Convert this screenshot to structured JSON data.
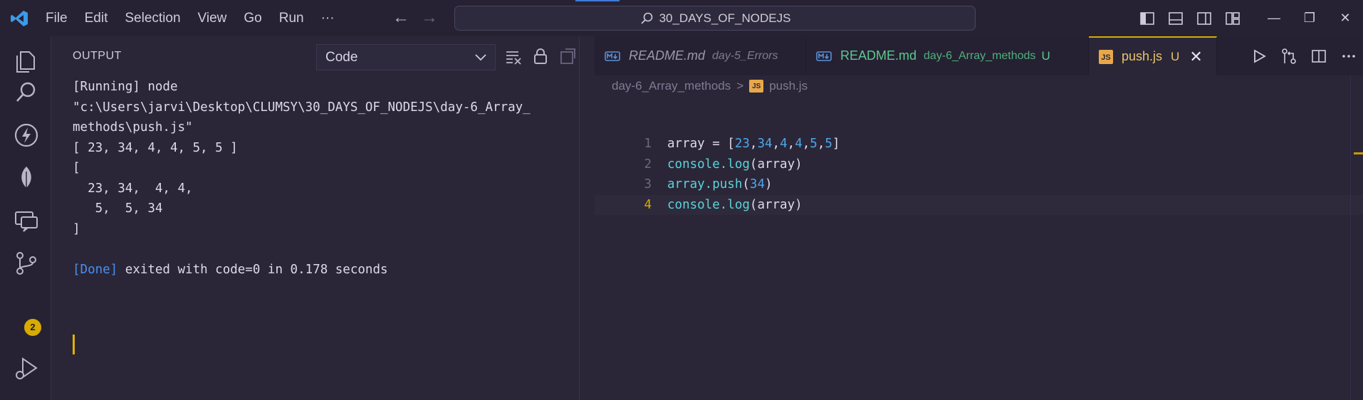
{
  "titlebar": {
    "menu": [
      "File",
      "Edit",
      "Selection",
      "View",
      "Go",
      "Run",
      "···"
    ],
    "search_text": "30_DAYS_OF_NODEJS",
    "window_controls": [
      "—",
      "❐",
      "✕"
    ]
  },
  "activitybar": {
    "items": [
      "explorer-icon",
      "search-icon",
      "thunder-icon",
      "leaf-icon",
      "remote-explorer-icon",
      "source-control-icon",
      "run-debug-icon"
    ],
    "source_control_badge": "2"
  },
  "output": {
    "title": "OUTPUT",
    "channel": "Code",
    "lines": [
      "[Running] node",
      "\"c:\\Users\\jarvi\\Desktop\\CLUMSY\\30_DAYS_OF_NODEJS\\day-6_Array_",
      "methods\\push.js\"",
      "[ 23, 34, 4, 4, 5, 5 ]",
      "[",
      "  23, 34,  4, 4,",
      "   5,  5, 34",
      "]",
      ""
    ],
    "done_tag": "[Done]",
    "done_text": " exited with code=0 in 0.178 seconds"
  },
  "editor": {
    "tabs": [
      {
        "name": "README.md",
        "desc": "day-5_Errors",
        "mod": ""
      },
      {
        "name": "README.md",
        "desc": "day-6_Array_methods",
        "mod": "U"
      },
      {
        "name": "push.js",
        "desc": "",
        "mod": "U"
      }
    ],
    "breadcrumb": {
      "folder": "day-6_Array_methods",
      "sep": ">",
      "file": "push.js",
      "file_badge": "JS"
    },
    "code_lines": [
      {
        "num": "1"
      },
      {
        "num": "2"
      },
      {
        "num": "3"
      },
      {
        "num": "4"
      }
    ],
    "code_tokens": {
      "array": "array",
      "eq": " = ",
      "open": "[",
      "close": "]",
      "comma": ",",
      "v1": "23",
      "v2": "34",
      "v3": "4",
      "v4": "4",
      "v5": "5",
      "v6": "5",
      "console_log": "console.log",
      "paren_open": "(",
      "paren_close": ")",
      "push": "array.push",
      "push_arg": "34"
    },
    "close_glyph": "✕"
  },
  "colors": {
    "accent": "#d8ab00",
    "done_blue": "#4b8ef0",
    "number_blue": "#4ea6e8",
    "function_cyan": "#5bd3d8",
    "git_green": "#5cc98f"
  }
}
